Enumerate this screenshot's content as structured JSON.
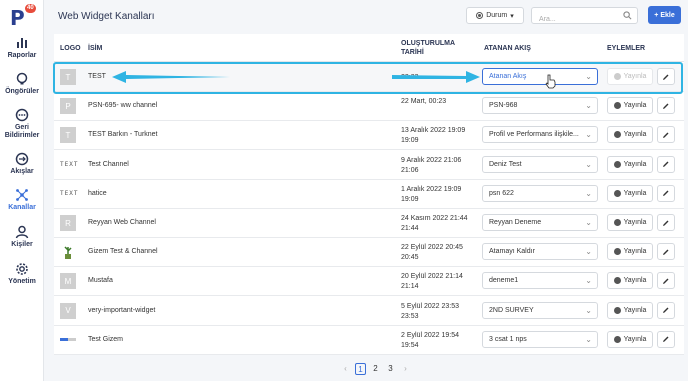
{
  "app": {
    "notification_count": "40"
  },
  "sidebar": {
    "items": [
      {
        "label": "Raporlar",
        "icon": "bar-chart-icon"
      },
      {
        "label": "Öngörüler",
        "icon": "lightbulb-icon"
      },
      {
        "label": "Geri Bildirimler",
        "icon": "chat-icon"
      },
      {
        "label": "Akışlar",
        "icon": "flow-icon"
      },
      {
        "label": "Kanallar",
        "icon": "channels-icon",
        "active": true
      },
      {
        "label": "Kişiler",
        "icon": "person-icon"
      },
      {
        "label": "Yönetim",
        "icon": "gear-icon"
      }
    ]
  },
  "header": {
    "title": "Web Widget Kanalları",
    "status_label": "Durum",
    "search_placeholder": "Ara...",
    "add_label": "+ Ekle"
  },
  "table": {
    "columns": {
      "logo": "LOGO",
      "name": "İSİM",
      "created": "OLUŞTURULMA TARİHİ",
      "flow": "ATANAN AKIŞ",
      "actions": "EYLEMLER"
    },
    "publish_label": "Yayınla",
    "rows": [
      {
        "logo": "letter",
        "letter": "T",
        "name": "TEST",
        "date": "22:33",
        "flow": "Atanan Akış",
        "publish_disabled": true
      },
      {
        "logo": "letter",
        "letter": "P",
        "name": "PSN-695- ww channel",
        "date": "22 Mart, 00:23",
        "flow": "PSN-968"
      },
      {
        "logo": "letter",
        "letter": "T",
        "name": "TEST Barkın - Turknet",
        "date": "13 Aralık 2022 19:09 19:09",
        "flow": "Profil ve Performans ilişkile..."
      },
      {
        "logo": "dots",
        "logo_text": "TEXT",
        "name": "Test Channel",
        "date": "9 Aralık 2022 21:06 21:06",
        "flow": "Deniz Test"
      },
      {
        "logo": "dots",
        "logo_text": "TEXT",
        "name": "hatice",
        "date": "1 Aralık 2022 19:09 19:09",
        "flow": "psn 622"
      },
      {
        "logo": "letter",
        "letter": "R",
        "name": "Reyyan Web Channel",
        "date": "24 Kasım 2022 21:44 21:44",
        "flow": "Reyyan Deneme"
      },
      {
        "logo": "plant",
        "name": "Gizem Test & Channel",
        "date": "22 Eylül 2022 20:45 20:45",
        "flow": "Atamayı Kaldır"
      },
      {
        "logo": "letter",
        "letter": "M",
        "name": "Mustafa",
        "date": "20 Eylül 2022 21:14 21:14",
        "flow": "deneme1"
      },
      {
        "logo": "letter",
        "letter": "V",
        "name": "very-important-widget",
        "date": "5 Eylül 2022 23:53 23:53",
        "flow": "2ND SURVEY"
      },
      {
        "logo": "line",
        "name": "Test Gizem",
        "date": "2 Eylül 2022 19:54 19:54",
        "flow": "3 csat 1 nps"
      }
    ]
  },
  "pagination": {
    "pages": [
      "1",
      "2",
      "3"
    ],
    "current": "1",
    "prev": "‹",
    "next": "›"
  },
  "colors": {
    "accent": "#3a6fd8",
    "highlight": "#2fb4e3",
    "badge": "#e74c3c"
  }
}
